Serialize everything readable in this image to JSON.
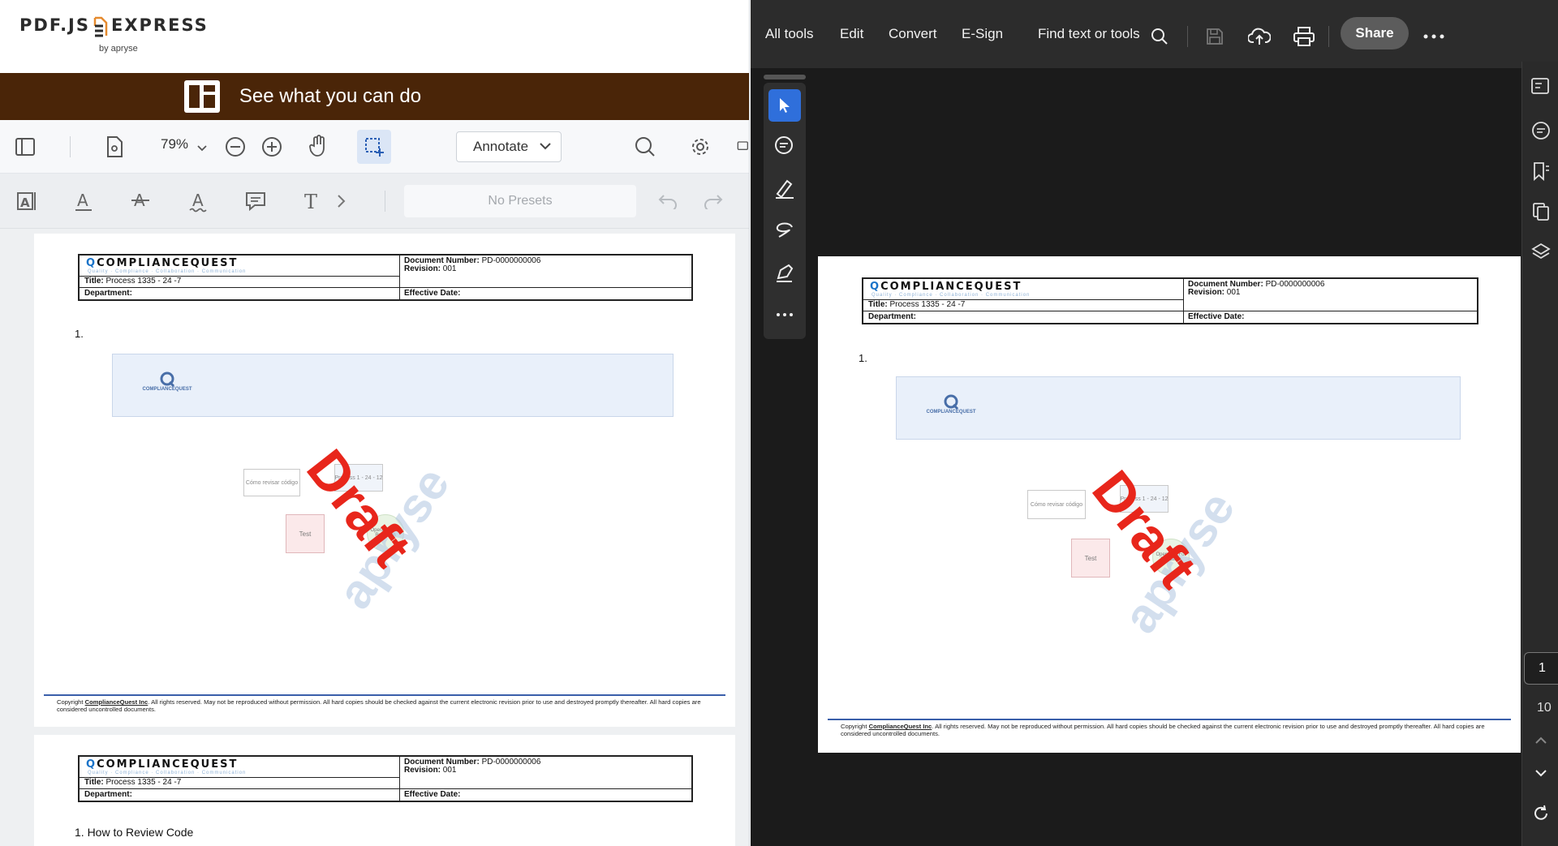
{
  "left_app": {
    "logo": {
      "text_left": "PDF.JS",
      "text_right": "EXPRESS",
      "sub": "by apryse"
    },
    "banner": {
      "text": "See what you can do"
    },
    "toolbar": {
      "zoom": "79%",
      "mode": "Annotate"
    },
    "annot_toolbar": {
      "presets": "No Presets"
    }
  },
  "document": {
    "logo_main": "COMPLIANCE",
    "logo_bold": "QUEST",
    "logo_tagline": "Quality · Compliance · Collaboration · Communication",
    "doc_number_label": "Document Number:",
    "doc_number": "PD-0000000006",
    "revision_label": "Revision:",
    "revision": "001",
    "title_label": "Title:",
    "title": "Process 1335 - 24 -7",
    "department_label": "Department:",
    "effective_label": "Effective Date:",
    "item1": "1.",
    "box_logo_text": "COMPLIANCEQUEST",
    "small_box_label": "Cómo revisar código",
    "process_label": "Process 1 - 24 - 12",
    "pink_box_label": "Test",
    "circle_label": "Operation For Rendition",
    "draft_label": "Draft",
    "watermark": "apryse",
    "footer_prefix": "Copyright ",
    "footer_company": "ComplianceQuest Inc",
    "footer_rest": ". All rights reserved. May not be reproduced without permission. All hard copies should be checked against the current electronic revision prior to use and destroyed promptly thereafter. All hard copies are considered uncontrolled documents.",
    "page2_item": "1. How to Review Code"
  },
  "right_app": {
    "menu": [
      "All tools",
      "Edit",
      "Convert",
      "E-Sign"
    ],
    "find": "Find text or tools",
    "share": "Share",
    "page_current": "1",
    "page_total": "10"
  },
  "colors": {
    "banner": "#4a2508",
    "draft": "#e8261b",
    "acrobat_bg": "#1b1b1b",
    "acrobat_accent": "#2f6fdb"
  }
}
